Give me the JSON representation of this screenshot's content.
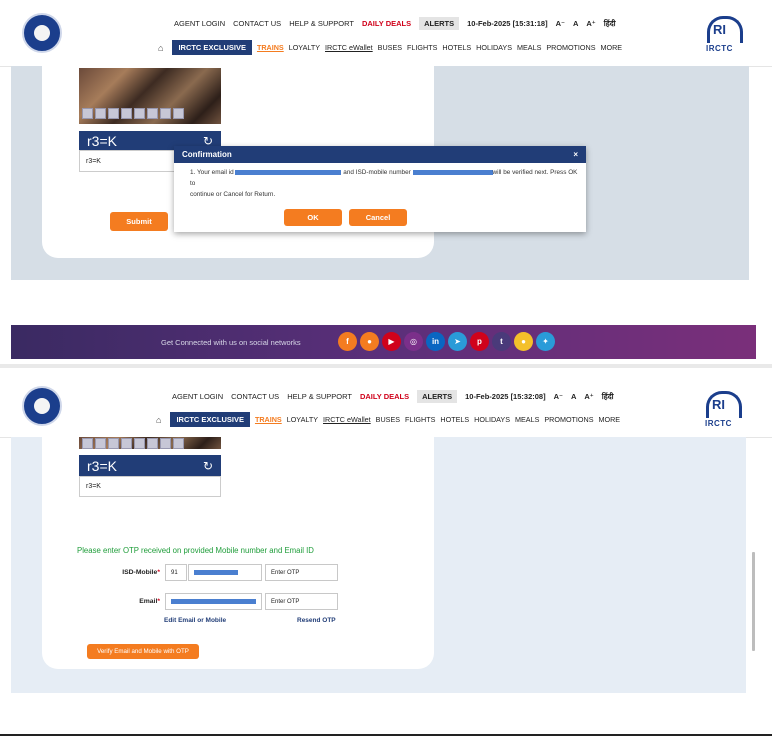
{
  "header": {
    "top_links": [
      "AGENT LOGIN",
      "CONTACT US",
      "HELP & SUPPORT"
    ],
    "daily_deals": "DAILY DEALS",
    "alerts": "ALERTS",
    "datetime_1": "10-Feb-2025 [15:31:18]",
    "datetime_2": "10-Feb-2025 [15:32:08]",
    "font_small": "A⁻",
    "font_normal": "A",
    "font_large": "A⁺",
    "hindi": "हिंदी",
    "home_icon": "⌂",
    "exclusive": "IRCTC EXCLUSIVE",
    "nav": [
      "TRAINS",
      "LOYALTY",
      "IRCTC eWallet",
      "BUSES",
      "FLIGHTS",
      "HOTELS",
      "HOLIDAYS",
      "MEALS",
      "PROMOTIONS",
      "MORE"
    ],
    "right_logo_text": "IRCTC",
    "right_logo_mark": "RI"
  },
  "captcha": {
    "text": "r3=K",
    "input_value": "r3=K",
    "refresh_icon": "↻"
  },
  "panel1": {
    "submit_label": "Submit",
    "modal": {
      "title": "Confirmation",
      "close": "×",
      "line_prefix": "1. Your email id",
      "line_mid": "and ISD-mobile number",
      "line_suffix": "will be verified next. Press OK to",
      "line_2": "continue or Cancel for Return.",
      "ok_label": "OK",
      "cancel_label": "Cancel"
    },
    "social_text": "Get Connected with us on social networks",
    "social_icons": [
      {
        "name": "facebook",
        "glyph": "f",
        "color": "#f47c20"
      },
      {
        "name": "messenger",
        "glyph": "●",
        "color": "#f47c20"
      },
      {
        "name": "youtube",
        "glyph": "▶",
        "color": "#d0021b"
      },
      {
        "name": "instagram",
        "glyph": "◎",
        "color": "#7b2f8a"
      },
      {
        "name": "linkedin",
        "glyph": "in",
        "color": "#0a66c2"
      },
      {
        "name": "telegram",
        "glyph": "➤",
        "color": "#2a9bd8"
      },
      {
        "name": "pinterest",
        "glyph": "p",
        "color": "#d0021b"
      },
      {
        "name": "tumblr",
        "glyph": "t",
        "color": "#4a3a7a"
      },
      {
        "name": "koo",
        "glyph": "●",
        "color": "#f4c02a"
      },
      {
        "name": "twitter",
        "glyph": "✦",
        "color": "#2a9bd8"
      }
    ]
  },
  "panel2": {
    "otp_message": "Please enter OTP received on provided Mobile number and Email ID",
    "isd_label": "ISD-Mobile",
    "isd_code": "91",
    "email_label": "Email",
    "req": "*",
    "otp_placeholder": "Enter OTP",
    "edit_link": "Edit Email or Mobile",
    "resend_link": "Resend OTP",
    "verify_label": "Verify Email and Mobile with OTP"
  },
  "colors": {
    "brand_blue": "#213d77",
    "accent_orange": "#f47c20",
    "alert_red": "#d0021b",
    "success_green": "#1f9d3a"
  }
}
